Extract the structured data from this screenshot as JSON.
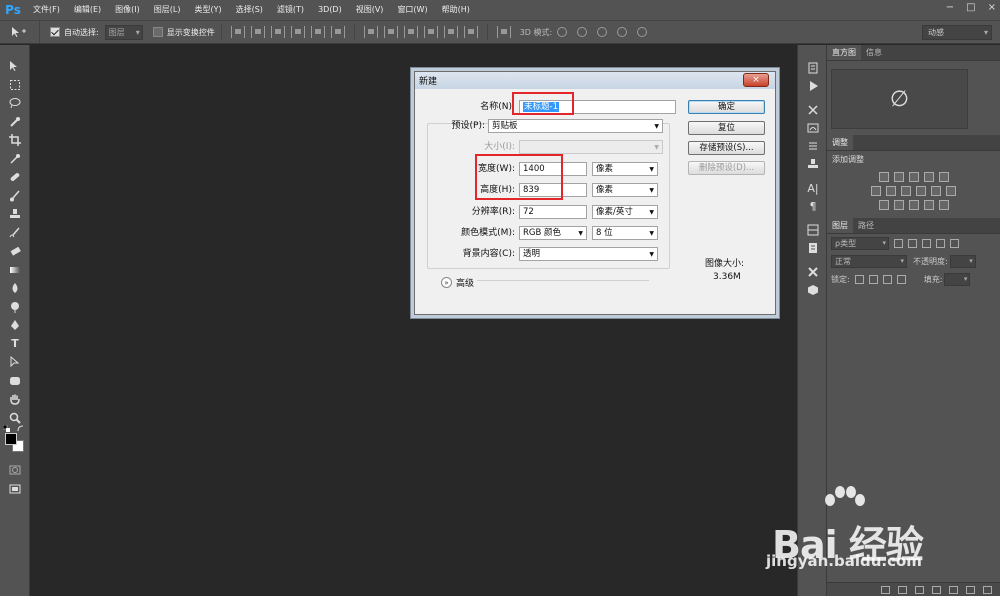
{
  "app": {
    "logo": "Ps",
    "menus": [
      "文件(F)",
      "编辑(E)",
      "图像(I)",
      "图层(L)",
      "类型(Y)",
      "选择(S)",
      "滤镜(T)",
      "3D(D)",
      "视图(V)",
      "窗口(W)",
      "帮助(H)"
    ],
    "window_controls": [
      "−",
      "□",
      "×"
    ]
  },
  "options_bar": {
    "auto_select_label": "自动选择:",
    "auto_select_checked": true,
    "target_select": "图层",
    "transform_label": "显示变换控件",
    "transform_checked": false,
    "mode_3d_label": "3D 模式:",
    "workspace": "动感"
  },
  "dialog": {
    "title": "新建",
    "close_glyph": "×",
    "name_label": "名称(N):",
    "name_value": "未标题-1",
    "preset_label": "预设(P):",
    "preset_value": "剪贴板",
    "size_label": "大小(I):",
    "size_value": "",
    "width_label": "宽度(W):",
    "width_value": "1400",
    "width_unit": "像素",
    "height_label": "高度(H):",
    "height_value": "839",
    "height_unit": "像素",
    "resolution_label": "分辨率(R):",
    "resolution_value": "72",
    "resolution_unit": "像素/英寸",
    "color_mode_label": "颜色模式(M):",
    "color_mode_value": "RGB 颜色",
    "bit_depth": "8 位",
    "background_label": "背景内容(C):",
    "background_value": "透明",
    "advanced_label": "高级",
    "image_size_label": "图像大小:",
    "image_size_value": "3.36M",
    "buttons": {
      "ok": "确定",
      "reset": "复位",
      "save_preset": "存储预设(S)...",
      "delete_preset": "删除预设(D)..."
    }
  },
  "panels": {
    "histogram_tabs": [
      "直方图",
      "信息"
    ],
    "histogram_glyph": "∅",
    "adjustments_tab": "调整",
    "adjustments_title": "添加调整",
    "layers_tabs": [
      "图层",
      "路径"
    ],
    "layers_kind": "ρ类型",
    "blend_mode": "正常",
    "opacity_label": "不透明度:",
    "lock_label": "锁定:",
    "fill_label": "填充:"
  },
  "watermark": {
    "text": "Bai 经验",
    "url": "jingyan.baidu.com"
  }
}
